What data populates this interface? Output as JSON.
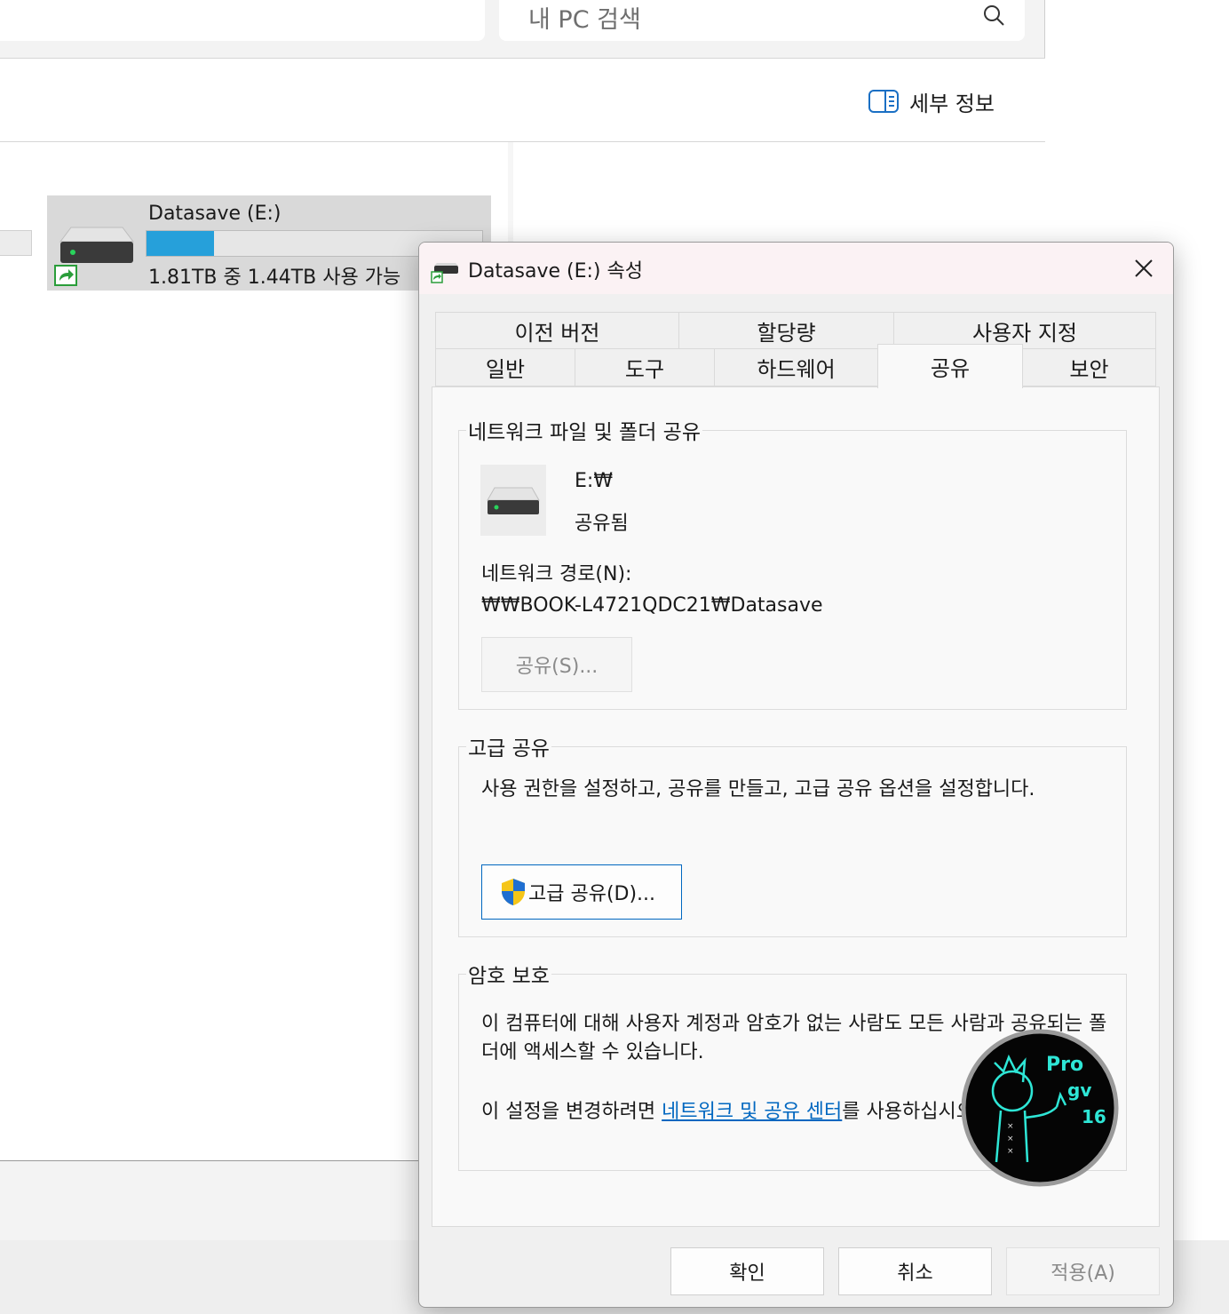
{
  "explorer": {
    "search": {
      "placeholder": "내 PC 검색"
    },
    "toolbar": {
      "details_label": "세부 정보"
    },
    "drive": {
      "name": "Datasave (E:)",
      "free_text": "1.81TB 중 1.44TB 사용 가능",
      "used_fraction": 0.2
    }
  },
  "dialog": {
    "title": "Datasave (E:) 속성",
    "tabs_row1": [
      "이전 버전",
      "할당량",
      "사용자 지정"
    ],
    "tabs_row2": [
      "일반",
      "도구",
      "하드웨어",
      "공유",
      "보안"
    ],
    "active_tab": "공유",
    "network_sharing": {
      "heading": "네트워크 파일 및 폴더 공유",
      "path_short": "E:₩",
      "status": "공유됨",
      "network_path_label": "네트워크 경로(N):",
      "network_path_value": "₩₩BOOK-L4721QDC21₩Datasave",
      "share_button": "공유(S)..."
    },
    "advanced_sharing": {
      "heading": "고급 공유",
      "description": "사용 권한을 설정하고, 공유를 만들고, 고급 공유 옵션을 설정합니다.",
      "button": "고급 공유(D)..."
    },
    "password_protection": {
      "heading": "암호 보호",
      "description": "이 컴퓨터에 대해 사용자 계정과 암호가 없는 사람도 모든 사람과 공유되는 폴더에 액세스할 수 있습니다.",
      "change_prefix": "이 설정을 변경하려면 ",
      "link_text": "네트워크 및 공유 센터",
      "change_suffix": "를 사용하십시오."
    },
    "footer": {
      "ok": "확인",
      "cancel": "취소",
      "apply": "적용(A)"
    }
  },
  "watermark": {
    "lines": [
      "Pro",
      "gv",
      "16"
    ]
  },
  "colors": {
    "accent": "#0067c0",
    "usage_bar": "#26a0da",
    "watermark_glow": "#2ee6d6"
  }
}
